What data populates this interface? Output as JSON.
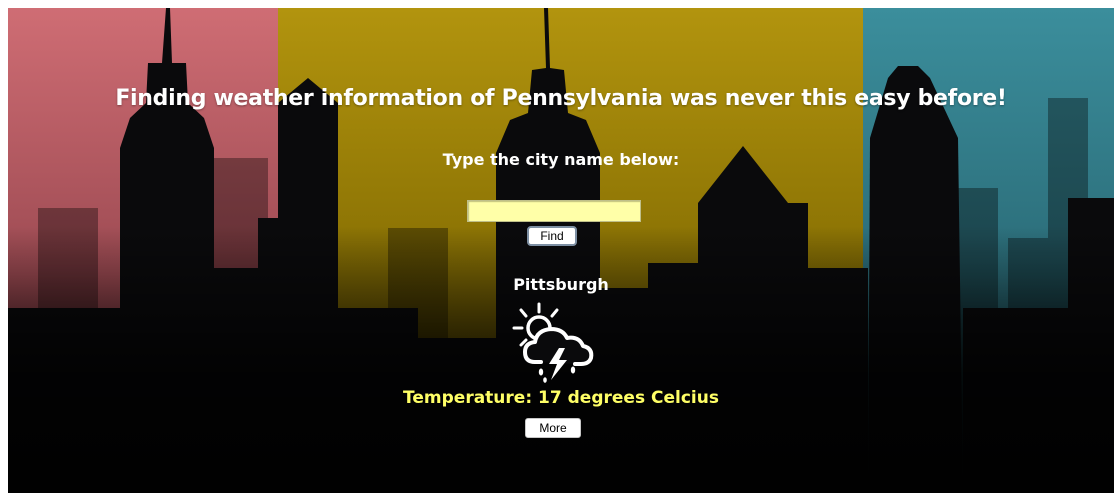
{
  "header": {
    "headline": "Finding weather information of Pennsylvania was never this easy before!",
    "prompt": "Type the city name below:"
  },
  "search": {
    "value": "",
    "placeholder": "",
    "find_label": "Find"
  },
  "result": {
    "city": "Pittsburgh",
    "icon": "sun-cloud-thunder-rain-icon",
    "temperature_prefix": "Temperature: ",
    "temperature_value": "17",
    "temperature_suffix": " degrees Celcius",
    "more_label": "More"
  },
  "colors": {
    "left_panel_tint": "#d86c74",
    "center_panel_tint": "#caa21a",
    "right_panel_tint": "#3c98a6",
    "input_background": "#ffffa8",
    "temperature_text": "#ffff66",
    "text": "#ffffff"
  }
}
